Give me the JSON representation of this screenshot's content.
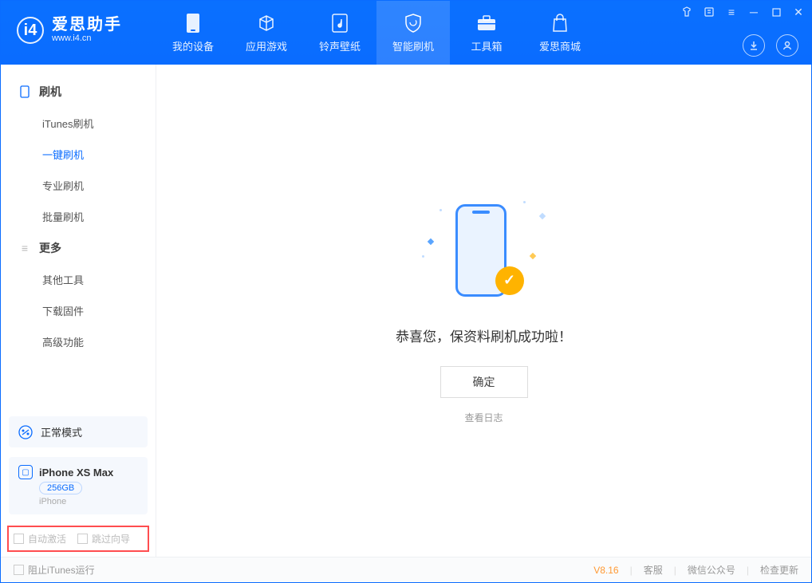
{
  "app": {
    "name": "爱思助手",
    "url": "www.i4.cn"
  },
  "nav": {
    "items": [
      {
        "label": "我的设备"
      },
      {
        "label": "应用游戏"
      },
      {
        "label": "铃声壁纸"
      },
      {
        "label": "智能刷机"
      },
      {
        "label": "工具箱"
      },
      {
        "label": "爱思商城"
      }
    ]
  },
  "sidebar": {
    "section1": {
      "title": "刷机",
      "items": [
        {
          "label": "iTunes刷机"
        },
        {
          "label": "一键刷机"
        },
        {
          "label": "专业刷机"
        },
        {
          "label": "批量刷机"
        }
      ]
    },
    "section2": {
      "title": "更多",
      "items": [
        {
          "label": "其他工具"
        },
        {
          "label": "下载固件"
        },
        {
          "label": "高级功能"
        }
      ]
    },
    "mode": "正常模式",
    "device": {
      "name": "iPhone XS Max",
      "storage": "256GB",
      "type": "iPhone"
    },
    "checks": {
      "auto": "自动激活",
      "skip": "跳过向导"
    }
  },
  "main": {
    "message": "恭喜您，保资料刷机成功啦！",
    "ok": "确定",
    "log": "查看日志"
  },
  "footer": {
    "block_itunes": "阻止iTunes运行",
    "version": "V8.16",
    "links": [
      "客服",
      "微信公众号",
      "检查更新"
    ]
  }
}
